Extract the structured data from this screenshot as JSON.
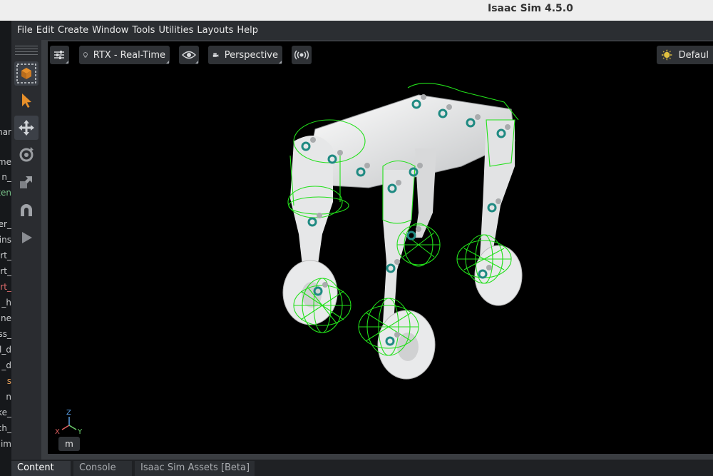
{
  "window": {
    "title": "Isaac Sim 4.5.0"
  },
  "menu": [
    "File",
    "Edit",
    "Create",
    "Window",
    "Tools",
    "Utilities",
    "Layouts",
    "Help"
  ],
  "left_strip": [
    {
      "text": "har",
      "color": "#c9cbcd"
    },
    {
      "text": "me",
      "color": "#c9cbcd"
    },
    {
      "text": "n_",
      "color": "#c9cbcd"
    },
    {
      "text": "ten",
      "color": "#79c38a"
    },
    {
      "text": "er_",
      "color": "#c9cbcd"
    },
    {
      "text": "_ins",
      "color": "#c9cbcd"
    },
    {
      "text": "rt_",
      "color": "#c9cbcd"
    },
    {
      "text": "rt_",
      "color": "#c9cbcd"
    },
    {
      "text": "rt_",
      "color": "#e06c6c"
    },
    {
      "text": "_h",
      "color": "#c9cbcd"
    },
    {
      "text": "ine",
      "color": "#c9cbcd"
    },
    {
      "text": "ss_",
      "color": "#c9cbcd"
    },
    {
      "text": "l_d",
      "color": "#c9cbcd"
    },
    {
      "text": "_d",
      "color": "#c9cbcd"
    },
    {
      "text": "s",
      "color": "#e8a05a"
    },
    {
      "text": "n",
      "color": "#c9cbcd"
    },
    {
      "text": "ke_",
      "color": "#c9cbcd"
    },
    {
      "text": "ch_",
      "color": "#c9cbcd"
    },
    {
      "text": "im",
      "color": "#c9cbcd"
    }
  ],
  "tools": [
    {
      "name": "select-mode-icon",
      "active": true
    },
    {
      "name": "select-arrow-icon",
      "active": false
    },
    {
      "name": "move-icon",
      "active": true
    },
    {
      "name": "rotate-icon",
      "active": false
    },
    {
      "name": "scale-icon",
      "active": false
    },
    {
      "name": "snap-magnet-icon",
      "active": false
    },
    {
      "name": "play-icon",
      "active": false
    }
  ],
  "viewport": {
    "settings_icon": "sliders-icon",
    "renderer": "RTX - Real-Time",
    "visibility_icon": "eye-icon",
    "camera": "Perspective",
    "audio_icon": "broadcast-icon",
    "lighting": "Defaul",
    "axes": {
      "z": "Z",
      "x": "X",
      "y": "Y"
    },
    "unit": "m"
  },
  "bottom_tabs": [
    "Content",
    "Console",
    "Isaac Sim Assets [Beta]"
  ],
  "colors": {
    "accent_green": "#22e01a",
    "joint_teal": "#1f8a82",
    "tool_orange": "#e8902a"
  }
}
